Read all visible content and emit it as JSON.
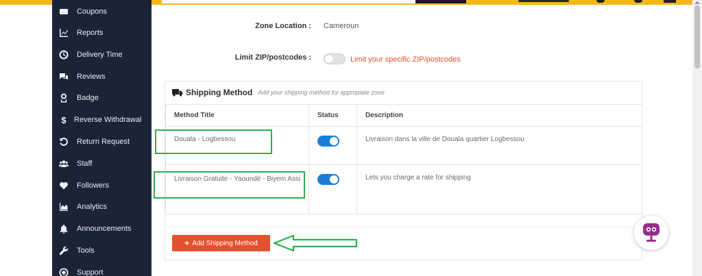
{
  "sidebar": {
    "items": [
      {
        "label": "Coupons",
        "icon": "coupon-icon"
      },
      {
        "label": "Reports",
        "icon": "reports-chart-icon"
      },
      {
        "label": "Delivery Time",
        "icon": "clock-icon"
      },
      {
        "label": "Reviews",
        "icon": "reviews-chat-icon"
      },
      {
        "label": "Badge",
        "icon": "badge-icon"
      },
      {
        "label": "Reverse Withdrawal",
        "icon": "dollar-icon"
      },
      {
        "label": "Return Request",
        "icon": "return-icon"
      },
      {
        "label": "Staff",
        "icon": "staff-users-icon"
      },
      {
        "label": "Followers",
        "icon": "heart-icon"
      },
      {
        "label": "Analytics",
        "icon": "analytics-area-icon"
      },
      {
        "label": "Announcements",
        "icon": "bell-icon"
      },
      {
        "label": "Tools",
        "icon": "wrench-icon"
      },
      {
        "label": "Support",
        "icon": "support-globe-icon"
      }
    ]
  },
  "zone": {
    "location_label": "Zone Location :",
    "location_value": "Cameroun",
    "limit_label": "Limit ZIP/postcodes :",
    "limit_text": "Limit your specific ZIP/postcodes"
  },
  "shipping": {
    "title": "Shipping Method",
    "subtitle": "Add your shipping method for appropiate zone",
    "columns": {
      "method": "Method Title",
      "status": "Status",
      "description": "Description"
    },
    "rows": [
      {
        "method": "Douala - Logbessou",
        "enabled": true,
        "description": "Livraison dans la ville de Douala quartier Logbessou"
      },
      {
        "method": "Livraison Gratuite - Yaoundé - Biyem Assi",
        "enabled": true,
        "description": "Lets you charge a rate for shipping"
      }
    ],
    "add_button": "Add Shipping Method"
  },
  "colors": {
    "topbar": "#f7b71a",
    "sidebar": "#1b2437",
    "accent": "#e5512e",
    "toggle_on": "#1a7fd6",
    "highlight": "#2bb04a"
  }
}
